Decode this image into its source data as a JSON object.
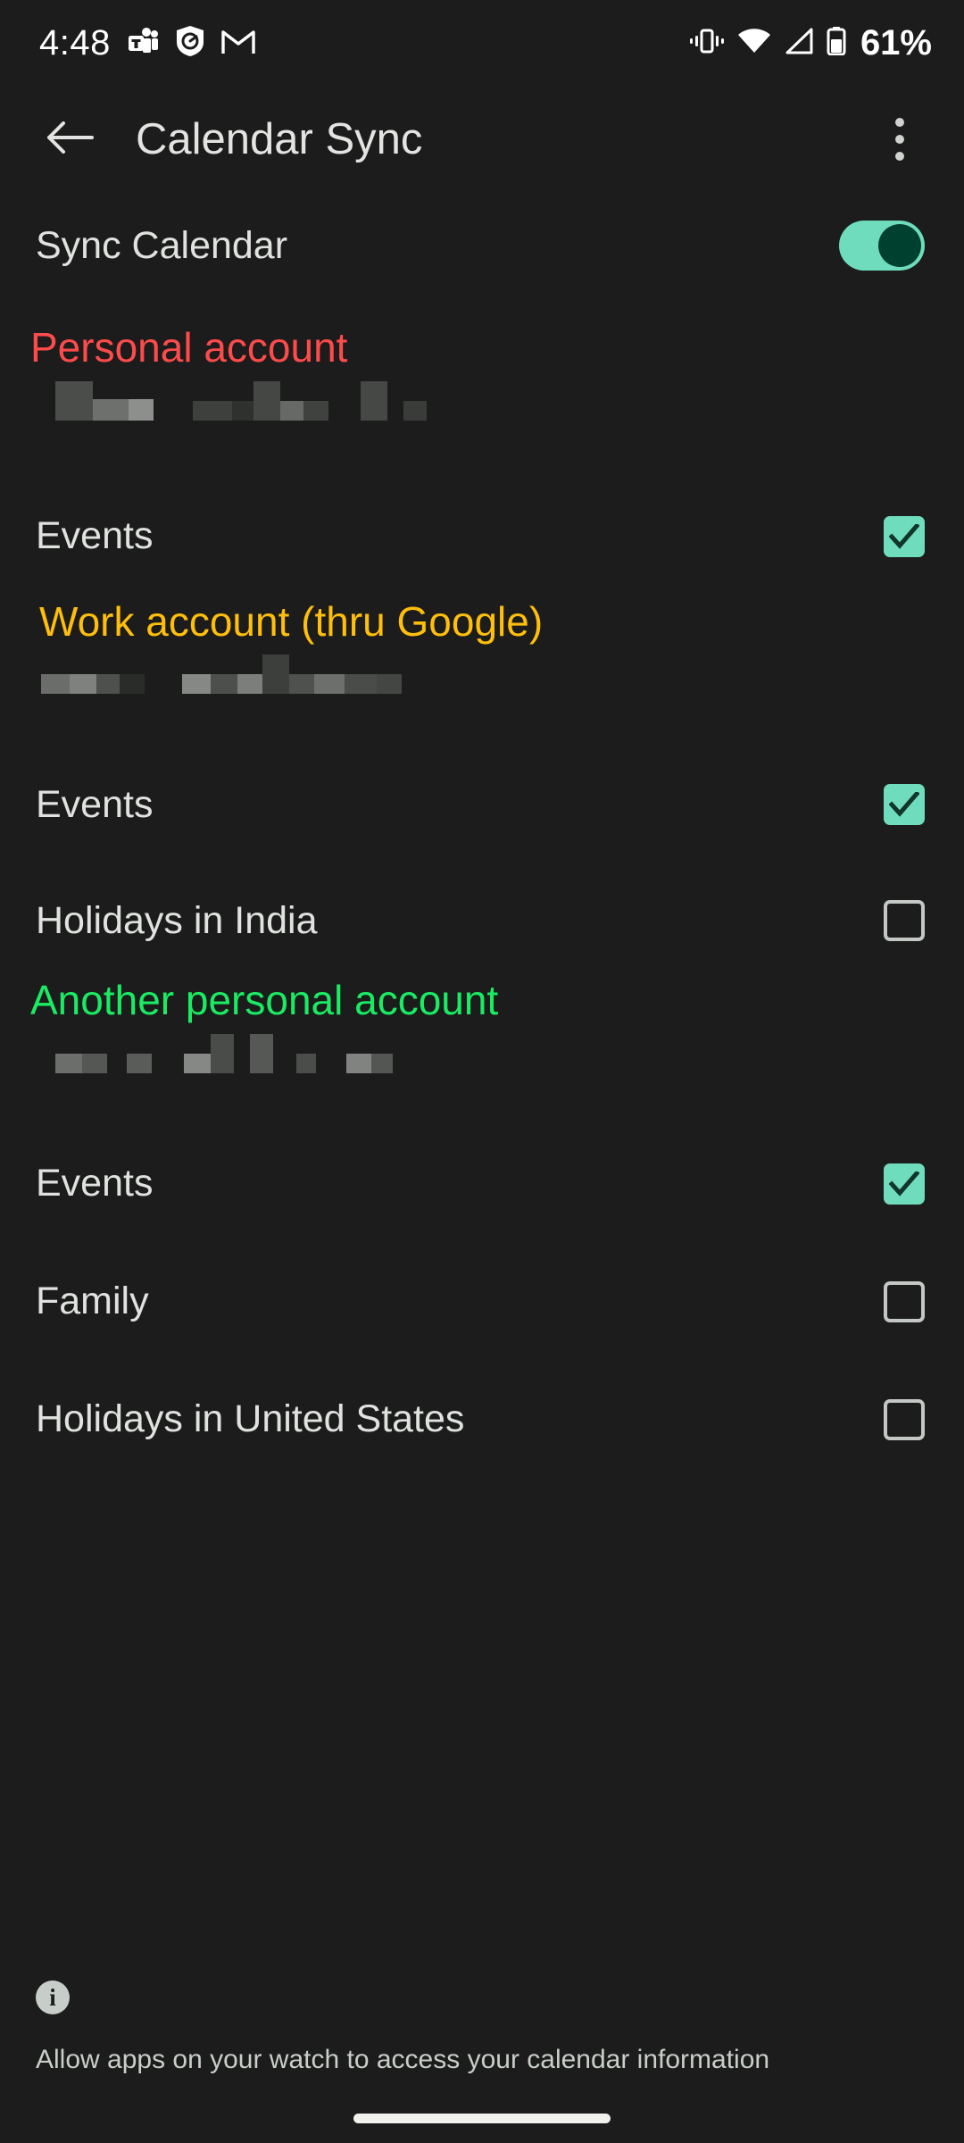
{
  "status_bar": {
    "time": "4:48",
    "battery_percent": "61%",
    "left_icons": [
      "teams-icon",
      "shield-icon",
      "gmail-icon"
    ],
    "right_icons": [
      "vibrate-icon",
      "wifi-icon",
      "cellular-signal-icon",
      "battery-icon"
    ]
  },
  "app_bar": {
    "title": "Calendar Sync",
    "back_icon": "back-arrow-icon",
    "overflow_icon": "overflow-menu-icon"
  },
  "master": {
    "label": "Sync Calendar",
    "toggle_on": true
  },
  "colors": {
    "background": "#1b1c1b",
    "accent_mint": "#6fddbd",
    "knob_dark_green": "#00402f",
    "account_red": "#fd4b4b",
    "account_amber": "#ffbe0b",
    "account_green": "#1aeb63",
    "text_primary": "#dfe2df",
    "checkbox_outline": "#c3c8c4"
  },
  "accounts": [
    {
      "name": "Personal account",
      "name_color": "#fd4b4b",
      "email_redacted": true,
      "calendars": [
        {
          "label": "Events",
          "checked": true
        }
      ]
    },
    {
      "name": "Work account (thru Google)",
      "name_color": "#ffbe0b",
      "email_redacted": true,
      "calendars": [
        {
          "label": "Events",
          "checked": true
        },
        {
          "label": "Holidays in India",
          "checked": false
        }
      ]
    },
    {
      "name": "Another personal account",
      "name_color": "#1aeb63",
      "email_redacted": true,
      "calendars": [
        {
          "label": "Events",
          "checked": true
        },
        {
          "label": "Family",
          "checked": false
        },
        {
          "label": "Holidays in United States",
          "checked": false
        }
      ]
    }
  ],
  "footer": {
    "info_icon": "info-icon",
    "info_glyph": "i",
    "text": "Allow apps on your watch to access your calendar information"
  }
}
